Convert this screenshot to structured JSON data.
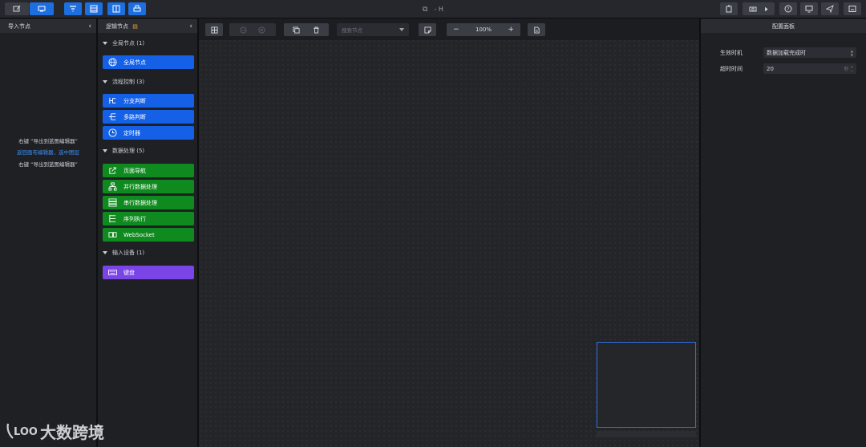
{
  "top_title": {
    "text": "- H",
    "icon": "window-icon"
  },
  "import_panel": {
    "title": "导入节点",
    "hints": [
      "右键 “导出到蓝图编辑器”",
      "返回画布编辑器，选中图层",
      "右键 “导出到蓝图编辑器”"
    ]
  },
  "logic_panel": {
    "title": "逻辑节点",
    "groups": [
      {
        "title": "全局节点 (1)",
        "nodes": [
          {
            "label": "全局节点",
            "icon": "globe-icon",
            "color": "#1461e8"
          }
        ]
      },
      {
        "title": "流程控制 (3)",
        "nodes": [
          {
            "label": "分支判断",
            "icon": "branch-icon",
            "color": "#1461e8"
          },
          {
            "label": "多路判断",
            "icon": "multi-branch-icon",
            "color": "#1461e8"
          },
          {
            "label": "定时器",
            "icon": "clock-icon",
            "color": "#1461e8"
          }
        ]
      },
      {
        "title": "数据处理 (5)",
        "nodes": [
          {
            "label": "页面导航",
            "icon": "external-link-icon",
            "color": "#0f8a1e"
          },
          {
            "label": "并行数据处理",
            "icon": "tree-icon",
            "color": "#0f8a1e"
          },
          {
            "label": "串行数据处理",
            "icon": "list-icon",
            "color": "#0f8a1e"
          },
          {
            "label": "序列执行",
            "icon": "sequence-icon",
            "color": "#0f8a1e"
          },
          {
            "label": "WebSocket",
            "icon": "socket-icon",
            "color": "#0f8a1e"
          }
        ]
      },
      {
        "title": "输入设备 (1)",
        "nodes": [
          {
            "label": "键盘",
            "icon": "keyboard-icon",
            "color": "#7a44e6"
          }
        ]
      }
    ]
  },
  "canvas_toolbar": {
    "search_placeholder": "搜索节点",
    "zoom_minus": "−",
    "zoom_value": "100%",
    "zoom_plus": "+"
  },
  "config_panel": {
    "title": "配置面板",
    "fields": [
      {
        "label": "生效时机",
        "value": "数据加载完成时"
      },
      {
        "label": "超时时间",
        "value": "20",
        "unit": "秒"
      }
    ]
  },
  "watermark": {
    "text": "大数跨境"
  }
}
